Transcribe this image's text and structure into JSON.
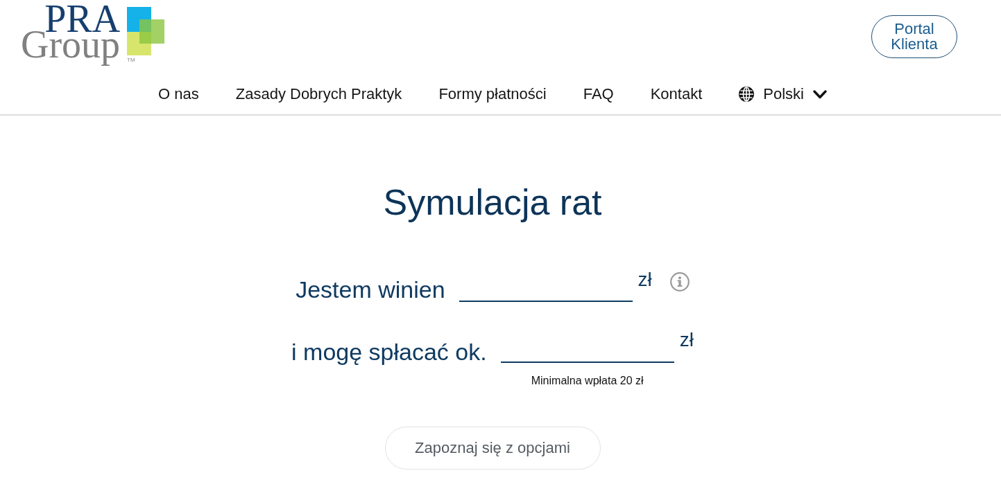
{
  "header": {
    "logo": {
      "line_1": "PRA",
      "line_2": "Group",
      "trademark": "TM"
    },
    "portal_button": {
      "label": "Portal Klienta"
    }
  },
  "nav": {
    "items": [
      {
        "label": "O nas"
      },
      {
        "label": "Zasady Dobrych Praktyk"
      },
      {
        "label": "Formy płatności"
      },
      {
        "label": "FAQ"
      },
      {
        "label": "Kontakt"
      }
    ],
    "language": {
      "label": "Polski"
    }
  },
  "title": "Symulacja rat",
  "form": {
    "fields": [
      {
        "label": "Jestem winien",
        "currency": "zł",
        "info": true
      },
      {
        "label": "i mogę spłacać ok.",
        "currency": "zł",
        "info": false,
        "hint": "Minimalna wpłata 20 zł"
      }
    ]
  },
  "submit_button": {
    "label": "Zapoznaj się z opcjami"
  }
}
